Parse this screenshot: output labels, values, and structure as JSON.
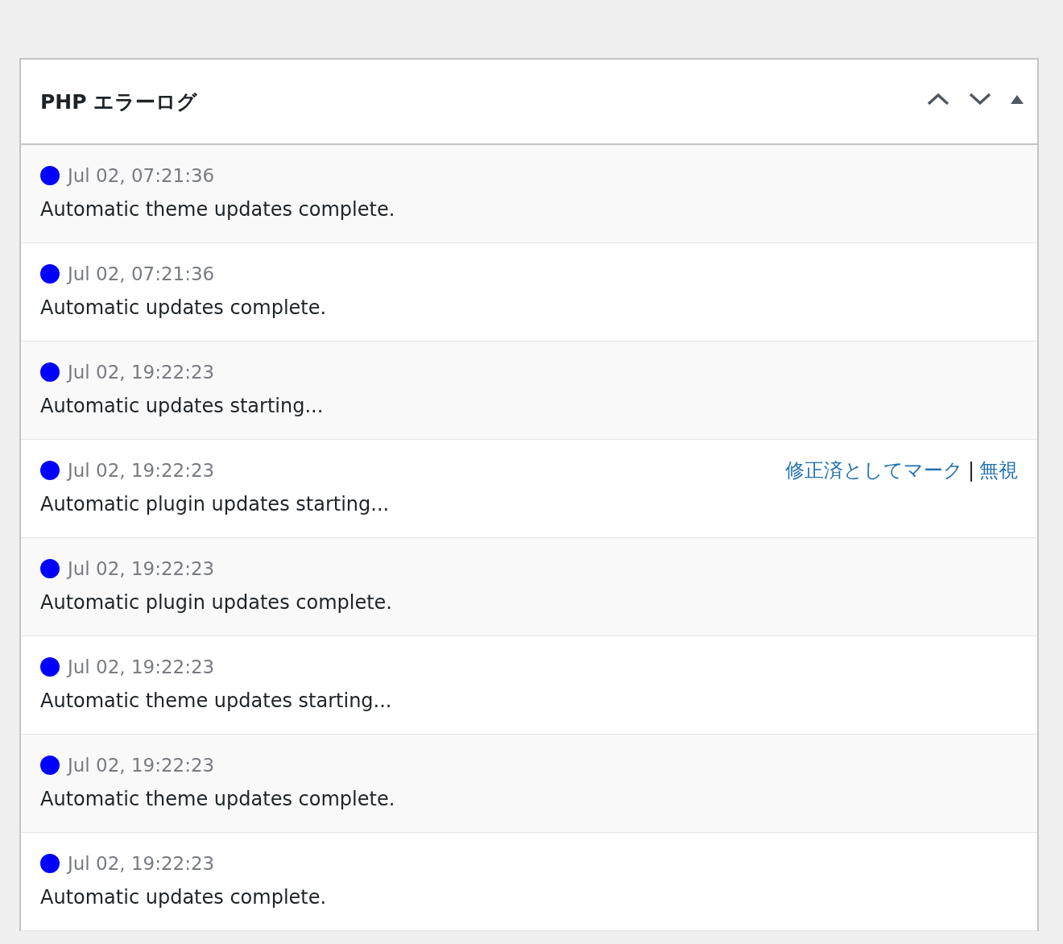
{
  "widget": {
    "title": "PHP エラーログ"
  },
  "entries": [
    {
      "time": "Jul 02, 07:21:36",
      "message": "Automatic theme updates complete.",
      "color": "#0000ff"
    },
    {
      "time": "Jul 02, 07:21:36",
      "message": "Automatic updates complete.",
      "color": "#0000ff"
    },
    {
      "time": "Jul 02, 19:22:23",
      "message": "Automatic updates starting...",
      "color": "#0000ff"
    },
    {
      "time": "Jul 02, 19:22:23",
      "message": "Automatic plugin updates starting...",
      "color": "#0000ff",
      "actions": {
        "mark_fixed": "修正済としてマーク",
        "separator": "|",
        "ignore": "無視"
      }
    },
    {
      "time": "Jul 02, 19:22:23",
      "message": "Automatic plugin updates complete.",
      "color": "#0000ff"
    },
    {
      "time": "Jul 02, 19:22:23",
      "message": "Automatic theme updates starting...",
      "color": "#0000ff"
    },
    {
      "time": "Jul 02, 19:22:23",
      "message": "Automatic theme updates complete.",
      "color": "#0000ff"
    },
    {
      "time": "Jul 02, 19:22:23",
      "message": "Automatic updates complete.",
      "color": "#0000ff"
    }
  ]
}
